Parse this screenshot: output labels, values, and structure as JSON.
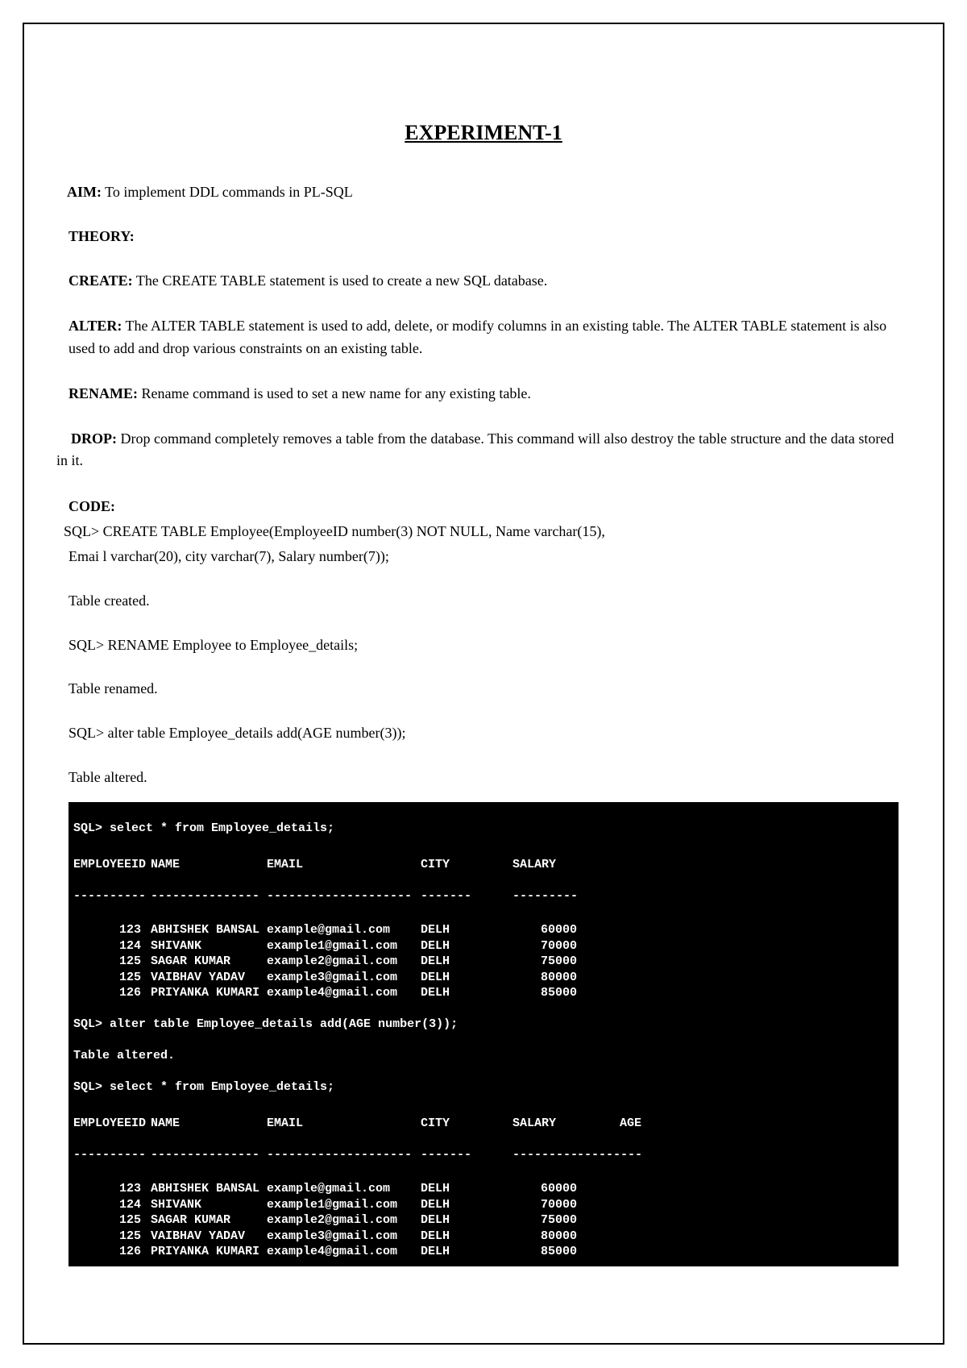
{
  "title": "EXPERIMENT-1",
  "aim_label": "AIM:",
  "aim_text": " To implement DDL commands in PL-SQL",
  "theory_label": "THEORY:",
  "create_label": "CREATE:",
  "create_text": " The CREATE TABLE statement is used to create a new SQL database.",
  "alter_label": "ALTER:",
  "alter_text": " The ALTER TABLE statement is used to add, delete, or modify columns in an existing table. The ALTER TABLE statement is also used to add and drop various constraints on an existing table.",
  "rename_label": "RENAME:",
  "rename_text": " Rename command is used to set a new name for any existing table.",
  "drop_label": "DROP:",
  "drop_text": " Drop command completely removes a table from the database. This command will also destroy the table structure and the data stored in it.",
  "code_label": "CODE:",
  "code_lines": {
    "l1": "SQL> CREATE TABLE Employee(EmployeeID number(3) NOT NULL, Name varchar(15),",
    "l2": "Emai l varchar(20), city varchar(7), Salary number(7));",
    "l3": "Table created.",
    "l4": "SQL> RENAME Employee to Employee_details;",
    "l5": "Table renamed.",
    "l6": "SQL> alter table Employee_details add(AGE number(3));",
    "l7": "Table altered."
  },
  "terminal": {
    "q1": "SQL> select * from Employee_details;",
    "headers": {
      "id": "EMPLOYEEID",
      "name": "NAME",
      "email": "EMAIL",
      "city": "CITY",
      "salary": "SALARY",
      "age": "AGE"
    },
    "dashes": {
      "id": "----------",
      "name": "---------------",
      "email": "--------------------",
      "city": "-------",
      "salary": "----------",
      "age": "----------"
    },
    "rows1": [
      {
        "id": "123",
        "name": "ABHISHEK BANSAL",
        "email": "example@gmail.com",
        "city": "DELH",
        "salary": "60000"
      },
      {
        "id": "124",
        "name": "SHIVANK",
        "email": "example1@gmail.com",
        "city": "DELH",
        "salary": "70000"
      },
      {
        "id": "125",
        "name": "SAGAR KUMAR",
        "email": "example2@gmail.com",
        "city": "DELH",
        "salary": "75000"
      },
      {
        "id": "125",
        "name": "VAIBHAV YADAV",
        "email": "example3@gmail.com",
        "city": "DELH",
        "salary": "80000"
      },
      {
        "id": "126",
        "name": "PRIYANKA KUMARI",
        "email": "example4@gmail.com",
        "city": "DELH",
        "salary": "85000"
      }
    ],
    "q2": "SQL> alter table Employee_details add(AGE number(3));",
    "r2": "Table altered.",
    "q3": "SQL> select * from Employee_details;",
    "rows2": [
      {
        "id": "123",
        "name": "ABHISHEK BANSAL",
        "email": "example@gmail.com",
        "city": "DELH",
        "salary": "60000",
        "age": ""
      },
      {
        "id": "124",
        "name": "SHIVANK",
        "email": "example1@gmail.com",
        "city": "DELH",
        "salary": "70000",
        "age": ""
      },
      {
        "id": "125",
        "name": "SAGAR KUMAR",
        "email": "example2@gmail.com",
        "city": "DELH",
        "salary": "75000",
        "age": ""
      },
      {
        "id": "125",
        "name": "VAIBHAV YADAV",
        "email": "example3@gmail.com",
        "city": "DELH",
        "salary": "80000",
        "age": ""
      },
      {
        "id": "126",
        "name": "PRIYANKA KUMARI",
        "email": "example4@gmail.com",
        "city": "DELH",
        "salary": "85000",
        "age": ""
      }
    ]
  }
}
